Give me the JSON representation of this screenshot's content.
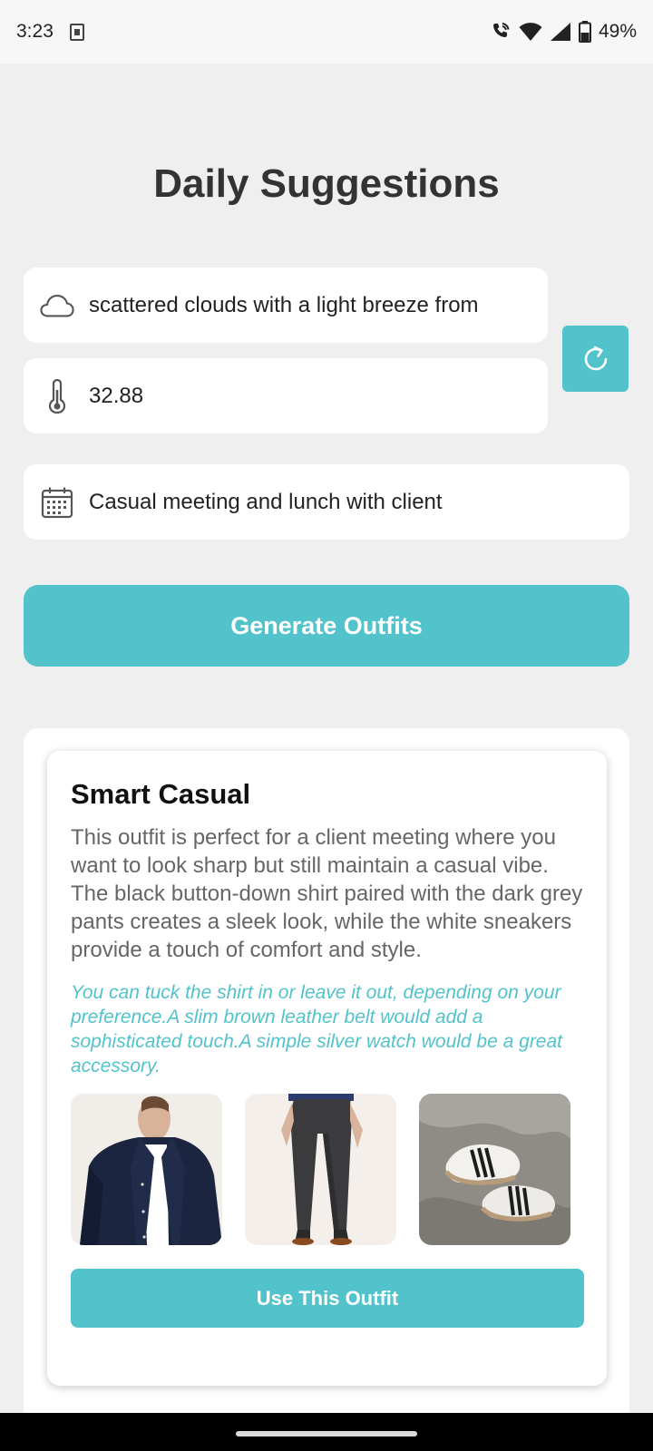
{
  "status_bar": {
    "time": "3:23",
    "battery": "49%",
    "icons": [
      "sim-card-icon",
      "wifi-calling-icon",
      "wifi-icon",
      "cell-signal-icon",
      "battery-icon"
    ]
  },
  "page": {
    "title": "Daily Suggestions"
  },
  "inputs": {
    "weather": {
      "icon": "cloud-icon",
      "value": "scattered clouds with a light breeze from"
    },
    "temperature": {
      "icon": "thermometer-icon",
      "value": "32.88"
    },
    "event": {
      "icon": "calendar-icon",
      "value": "Casual meeting and lunch with client"
    }
  },
  "refresh_button": {
    "icon": "refresh-icon"
  },
  "generate_button": {
    "label": "Generate Outfits"
  },
  "outfit": {
    "title": "Smart Casual",
    "description": "This outfit is perfect for a client meeting where you want to look sharp but still maintain a casual vibe. The black button-down shirt paired with the dark grey pants creates a sleek look, while the white sneakers provide a touch of comfort and style.",
    "tip": "You can tuck the shirt in or leave it out, depending on your preference.A slim brown leather belt would add a sophisticated touch.A simple silver watch would be a great accessory.",
    "items": [
      {
        "name": "shirt-image"
      },
      {
        "name": "pants-image"
      },
      {
        "name": "sneakers-image"
      }
    ],
    "use_button_label": "Use This Outfit"
  },
  "colors": {
    "accent": "#52c3cb",
    "background": "#efefef",
    "card": "#ffffff",
    "title_text": "#333333",
    "body_text": "#666666"
  }
}
